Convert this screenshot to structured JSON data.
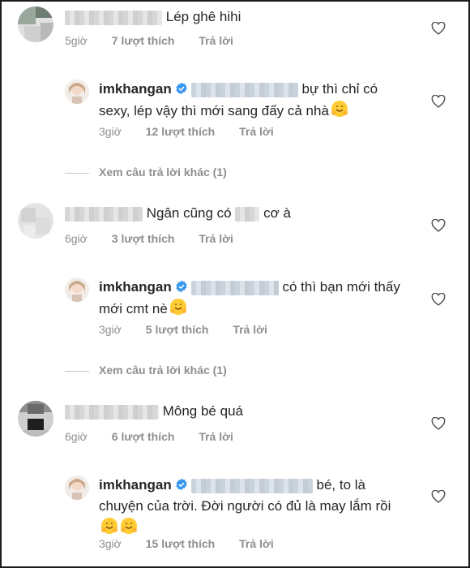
{
  "comments": [
    {
      "text": "Lép ghê hihi",
      "time": "5giờ",
      "likes": "7 lượt thích",
      "reply_label": "Trả lời"
    },
    {
      "username": "imkhangan",
      "text": "bự thì chỉ có sexy, lép vậy thì mới sang đấy cả nhà",
      "time": "3giờ",
      "likes": "12 lượt thích",
      "reply_label": "Trả lời"
    },
    {
      "more_replies": "Xem câu trả lời khác (1)"
    },
    {
      "text_before": "Ngân cũng có",
      "text_after": "cơ à",
      "time": "6giờ",
      "likes": "3 lượt thích",
      "reply_label": "Trả lời"
    },
    {
      "username": "imkhangan",
      "text": "có thì bạn mới thấy mới cmt nè",
      "time": "3giờ",
      "likes": "5 lượt thích",
      "reply_label": "Trả lời"
    },
    {
      "more_replies": "Xem câu trả lời khác (1)"
    },
    {
      "text": "Mông bé quá",
      "time": "6giờ",
      "likes": "6 lượt thích",
      "reply_label": "Trả lời"
    },
    {
      "username": "imkhangan",
      "text": "bé, to là chuyện của trời. Đời người có đủ là may lắm rồi",
      "time": "3giờ",
      "likes": "15 lượt thích",
      "reply_label": "Trả lời"
    }
  ],
  "icons": {
    "like": "heart-outline-icon",
    "verified": "verified-badge-icon",
    "emoji": "hugging-face-emoji"
  },
  "colors": {
    "verified": "#3897f0",
    "meta": "#8e8e8e",
    "text": "#262626"
  }
}
